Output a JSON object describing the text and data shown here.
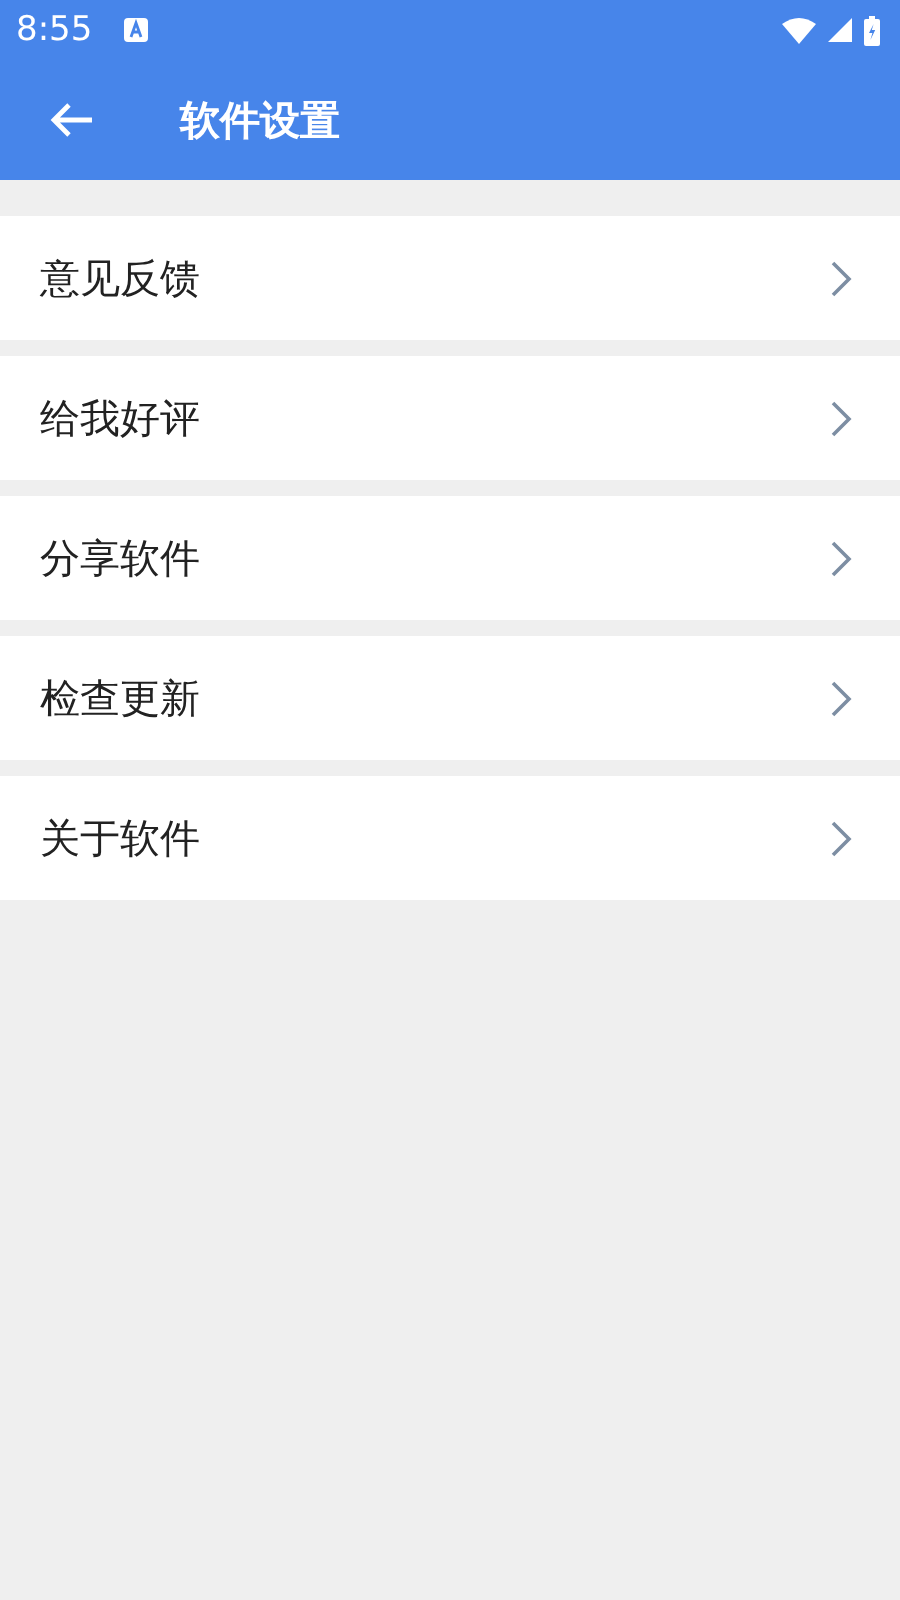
{
  "status_bar": {
    "time": "8:55"
  },
  "app_bar": {
    "title": "软件设置"
  },
  "menu_items": [
    {
      "label": "意见反馈"
    },
    {
      "label": "给我好评"
    },
    {
      "label": "分享软件"
    },
    {
      "label": "检查更新"
    },
    {
      "label": "关于软件"
    }
  ]
}
